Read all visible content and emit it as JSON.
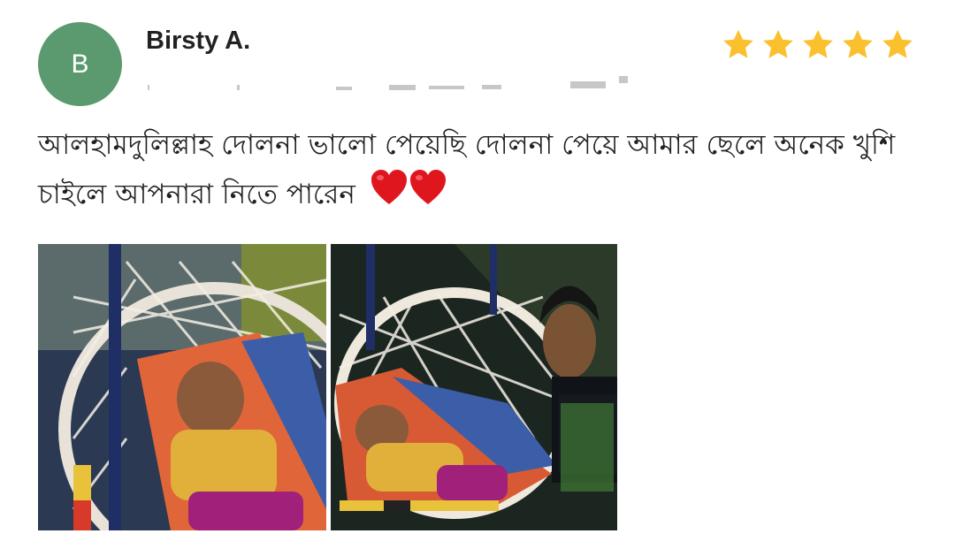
{
  "review": {
    "avatar_initial": "B",
    "reviewer_name": "Birsty A.",
    "rating": 5,
    "rating_max": 5,
    "text": "আলহামদুলিল্লাহ দোলনা ভালো পেয়েছি দোলনা পেয়ে আমার ছেলে অনেক খুশি চাইলে আপনারা নিতে পারেন",
    "emoji": "❤️❤️"
  },
  "colors": {
    "avatar_bg": "#5a9a6e",
    "star": "#fbc02d",
    "heart": "#e0161f"
  },
  "icons": {
    "star": "star-icon",
    "heart": "heart-icon"
  },
  "photos": [
    {
      "name": "review-photo-baby-in-swing-1"
    },
    {
      "name": "review-photo-baby-in-swing-2"
    }
  ]
}
